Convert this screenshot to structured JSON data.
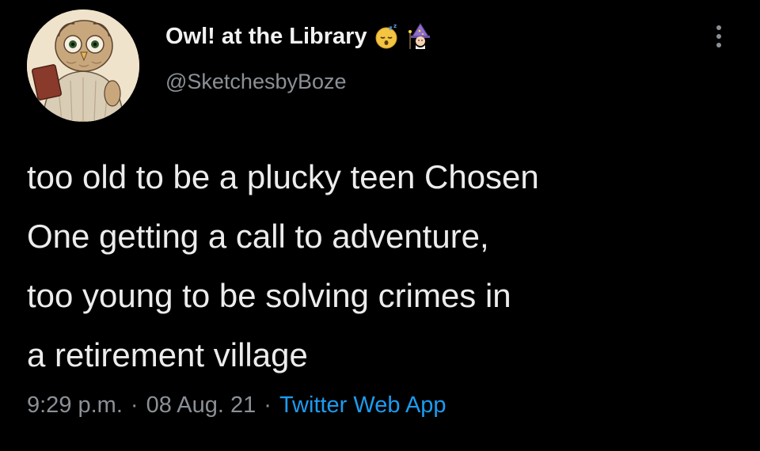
{
  "user": {
    "display_name": "Owl! at the Library",
    "handle": "@SketchesbyBoze",
    "avatar_icon": "owl-avatar",
    "name_emojis": [
      "sleeping-face-emoji",
      "wizard-emoji"
    ]
  },
  "tweet": {
    "text_lines": [
      "too old to be a plucky teen Chosen",
      "One getting a call to adventure,",
      "too young to be solving crimes in",
      "a retirement village"
    ]
  },
  "meta": {
    "time": "9:29 p.m.",
    "separator": "·",
    "date": "08 Aug. 21",
    "source": "Twitter Web App"
  },
  "colors": {
    "background": "#000000",
    "text": "#ececec",
    "secondary": "#8b9096",
    "link": "#1d9bf0"
  }
}
